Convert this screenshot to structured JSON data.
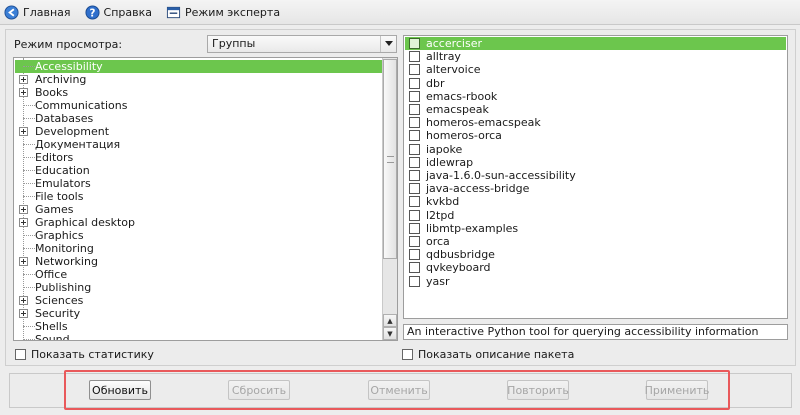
{
  "toolbar": {
    "items": [
      {
        "label": "Главная",
        "icon": "home-arrow-icon"
      },
      {
        "label": "Справка",
        "icon": "help-icon"
      },
      {
        "label": "Режим эксперта",
        "icon": "expert-mode-icon"
      }
    ]
  },
  "view_mode": {
    "label": "Режим просмотра:",
    "selected": "Группы"
  },
  "groups": [
    {
      "label": "Accessibility",
      "expandable": false,
      "selected": true
    },
    {
      "label": "Archiving",
      "expandable": true,
      "selected": false
    },
    {
      "label": "Books",
      "expandable": true,
      "selected": false
    },
    {
      "label": "Communications",
      "expandable": false,
      "selected": false
    },
    {
      "label": "Databases",
      "expandable": false,
      "selected": false
    },
    {
      "label": "Development",
      "expandable": true,
      "selected": false
    },
    {
      "label": "Документация",
      "expandable": false,
      "selected": false
    },
    {
      "label": "Editors",
      "expandable": false,
      "selected": false
    },
    {
      "label": "Education",
      "expandable": false,
      "selected": false
    },
    {
      "label": "Emulators",
      "expandable": false,
      "selected": false
    },
    {
      "label": "File tools",
      "expandable": false,
      "selected": false
    },
    {
      "label": "Games",
      "expandable": true,
      "selected": false
    },
    {
      "label": "Graphical desktop",
      "expandable": true,
      "selected": false
    },
    {
      "label": "Graphics",
      "expandable": false,
      "selected": false
    },
    {
      "label": "Monitoring",
      "expandable": false,
      "selected": false
    },
    {
      "label": "Networking",
      "expandable": true,
      "selected": false
    },
    {
      "label": "Office",
      "expandable": false,
      "selected": false
    },
    {
      "label": "Publishing",
      "expandable": false,
      "selected": false
    },
    {
      "label": "Sciences",
      "expandable": true,
      "selected": false
    },
    {
      "label": "Security",
      "expandable": true,
      "selected": false
    },
    {
      "label": "Shells",
      "expandable": false,
      "selected": false
    },
    {
      "label": "Sound",
      "expandable": false,
      "selected": false
    }
  ],
  "packages": [
    {
      "name": "accerciser",
      "selected": true
    },
    {
      "name": "alltray",
      "selected": false
    },
    {
      "name": "altervoice",
      "selected": false
    },
    {
      "name": "dbr",
      "selected": false
    },
    {
      "name": "emacs-rbook",
      "selected": false
    },
    {
      "name": "emacspeak",
      "selected": false
    },
    {
      "name": "homeros-emacspeak",
      "selected": false
    },
    {
      "name": "homeros-orca",
      "selected": false
    },
    {
      "name": "iapoke",
      "selected": false
    },
    {
      "name": "idlewrap",
      "selected": false
    },
    {
      "name": "java-1.6.0-sun-accessibility",
      "selected": false
    },
    {
      "name": "java-access-bridge",
      "selected": false
    },
    {
      "name": "kvkbd",
      "selected": false
    },
    {
      "name": "l2tpd",
      "selected": false
    },
    {
      "name": "libmtp-examples",
      "selected": false
    },
    {
      "name": "orca",
      "selected": false
    },
    {
      "name": "qdbusbridge",
      "selected": false
    },
    {
      "name": "qvkeyboard",
      "selected": false
    },
    {
      "name": "yasr",
      "selected": false
    }
  ],
  "description": "An interactive Python tool for querying accessibility information",
  "options": {
    "show_stats": "Показать статистику",
    "show_description": "Показать описание пакета"
  },
  "buttons": {
    "refresh": "Обновить",
    "reset": "Сбросить",
    "cancel": "Отменить",
    "redo": "Повторить",
    "apply": "Применить"
  },
  "colors": {
    "selection": "#6cc64d",
    "highlight_border": "#e9595b"
  }
}
